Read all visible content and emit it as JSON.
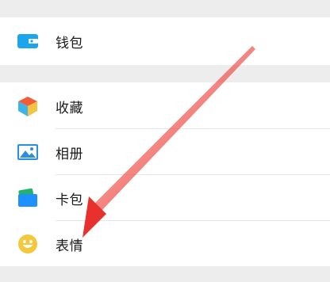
{
  "menu": {
    "group1": {
      "items": [
        {
          "label": "钱包",
          "icon": "wallet-icon",
          "icon_color": "#1aa5ec"
        }
      ]
    },
    "group2": {
      "items": [
        {
          "label": "收藏",
          "icon": "favorites-cube-icon",
          "icon_colors": [
            "#f25a3a",
            "#3cb4e6",
            "#f5c342"
          ]
        },
        {
          "label": "相册",
          "icon": "photo-album-icon",
          "icon_color": "#2a8fe0"
        },
        {
          "label": "卡包",
          "icon": "card-bag-icon",
          "icon_colors": [
            "#23b26a",
            "#1e90ff"
          ]
        },
        {
          "label": "表情",
          "icon": "sticker-smiley-icon",
          "icon_color": "#f4c83a"
        }
      ]
    }
  },
  "annotation": {
    "arrow_color": "#e8312f",
    "points_to": "表情"
  }
}
